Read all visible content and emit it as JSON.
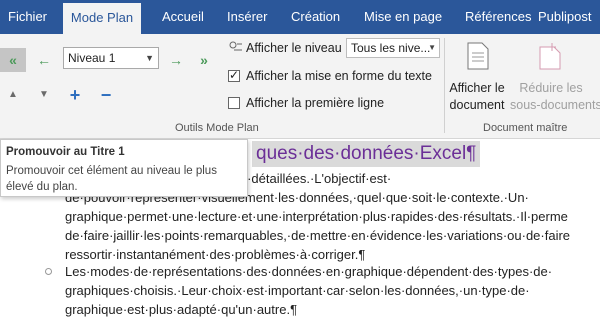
{
  "tabs": [
    {
      "label": "Fichier"
    },
    {
      "label": "Mode Plan"
    },
    {
      "label": "Accueil"
    },
    {
      "label": "Insérer"
    },
    {
      "label": "Création"
    },
    {
      "label": "Mise en page"
    },
    {
      "label": "Références"
    },
    {
      "label": "Publipost"
    }
  ],
  "active_tab": "Mode Plan",
  "ribbon": {
    "level_select": {
      "value": "Niveau 1"
    },
    "show_level_label": "Afficher le niveau :",
    "show_level_value": "Tous les nive...",
    "show_formatting": {
      "label": "Afficher la mise en forme du texte",
      "checked": true
    },
    "first_line_only": {
      "label": "Afficher la première ligne",
      "checked": false
    },
    "group_outline_tools": "Outils Mode Plan",
    "show_document": {
      "line1": "Afficher le",
      "line2": "document"
    },
    "collapse_subdocs": {
      "line1": "Réduire les",
      "line2": "sous-documents"
    },
    "group_master_document": "Document maître",
    "icons": {
      "promote_to_heading1": "double-arrow-left-icon",
      "promote": "arrow-left-icon",
      "demote": "arrow-right-icon",
      "demote_to_body": "double-arrow-right-icon",
      "move_up": "triangle-up-icon",
      "move_down": "triangle-down-icon",
      "expand": "plus-icon",
      "collapse": "minus-icon"
    },
    "colors": {
      "tabbar": "#2b579a",
      "green_arrows": "#4c9a5a",
      "blue_icons": "#2e6fbf"
    }
  },
  "tooltip": {
    "title": "Promouvoir au Titre 1",
    "description": "Promouvoir cet élément au niveau le plus élevé du plan."
  },
  "document": {
    "title_visible": "ques·des·données·Excel¶",
    "lines": [
      "aphiques·avec·des·options·très·détaillées.·L'objectif·est·",
      "de·pouvoir·représenter·visuellement·les·données,·quel·que·soit·le·contexte.·Un·",
      "graphique·permet·une·lecture·et·une·interprétation·plus·rapides·des·résultats.·Il·perme",
      "de·faire·jaillir·les·points·remarquables,·de·mettre·en·évidence·les·variations·ou·de·faire",
      "ressortir·instantanément·des·problèmes·à·corriger.¶",
      "Les·modes·de·représentations·des·données·en·graphique·dépendent·des·types·de·",
      "graphiques·choisis.·Leur·choix·est·important·car·selon·les·données,·un·type·de·",
      "graphique·est·plus·adapté·qu'un·autre.¶"
    ]
  }
}
